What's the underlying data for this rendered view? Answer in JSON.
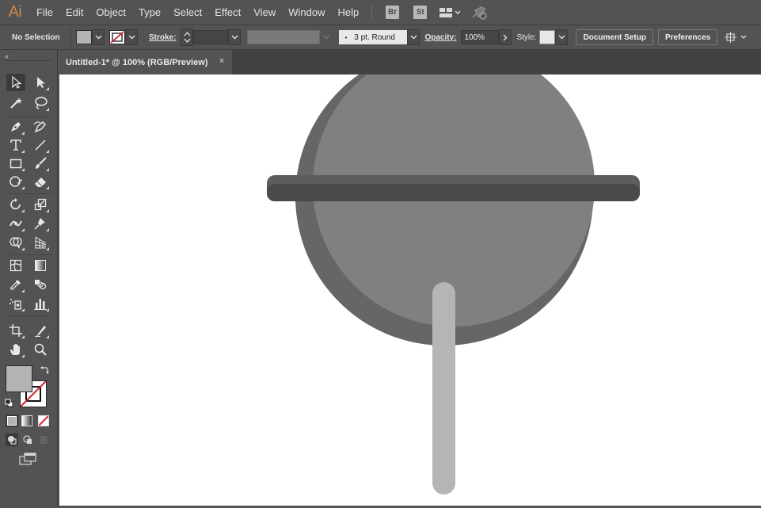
{
  "app": {
    "logo": "Ai"
  },
  "menu": [
    "File",
    "Edit",
    "Object",
    "Type",
    "Select",
    "Effect",
    "View",
    "Window",
    "Help"
  ],
  "menubar_badges": {
    "bridge": "Br",
    "stock": "St"
  },
  "control_bar": {
    "selection": "No Selection",
    "stroke_label": "Stroke:",
    "brush_value": "3 pt. Round",
    "opacity_label": "Opacity:",
    "opacity_value": "100%",
    "style_label": "Style:",
    "document_setup": "Document Setup",
    "preferences": "Preferences"
  },
  "document_tab": {
    "title": "Untitled-1* @ 100% (RGB/Preview)",
    "close": "×"
  },
  "toolbar": {
    "collapse": "«",
    "tools": [
      "selection",
      "direct-selection",
      "magic-wand",
      "lasso",
      "pen",
      "curvature",
      "type",
      "line-segment",
      "rectangle",
      "paintbrush",
      "shaper",
      "eraser",
      "rotate",
      "scale",
      "width",
      "puppet-warp",
      "shape-builder",
      "perspective-grid",
      "mesh",
      "gradient",
      "eyedropper",
      "blend",
      "symbol-sprayer",
      "column-graph",
      "artboard",
      "slice",
      "hand",
      "zoom"
    ]
  },
  "colors": {
    "ui_bg": "#535353",
    "canvas": "#ffffff",
    "circle_shadow": "#666666",
    "circle_face": "#808080",
    "bar_top": "#5d5d5d",
    "bar_bottom": "#4a4a4a",
    "stick": "#b5b5b5",
    "fill_swatch": "#b3b3b3",
    "stroke_none": "#d0202a"
  }
}
